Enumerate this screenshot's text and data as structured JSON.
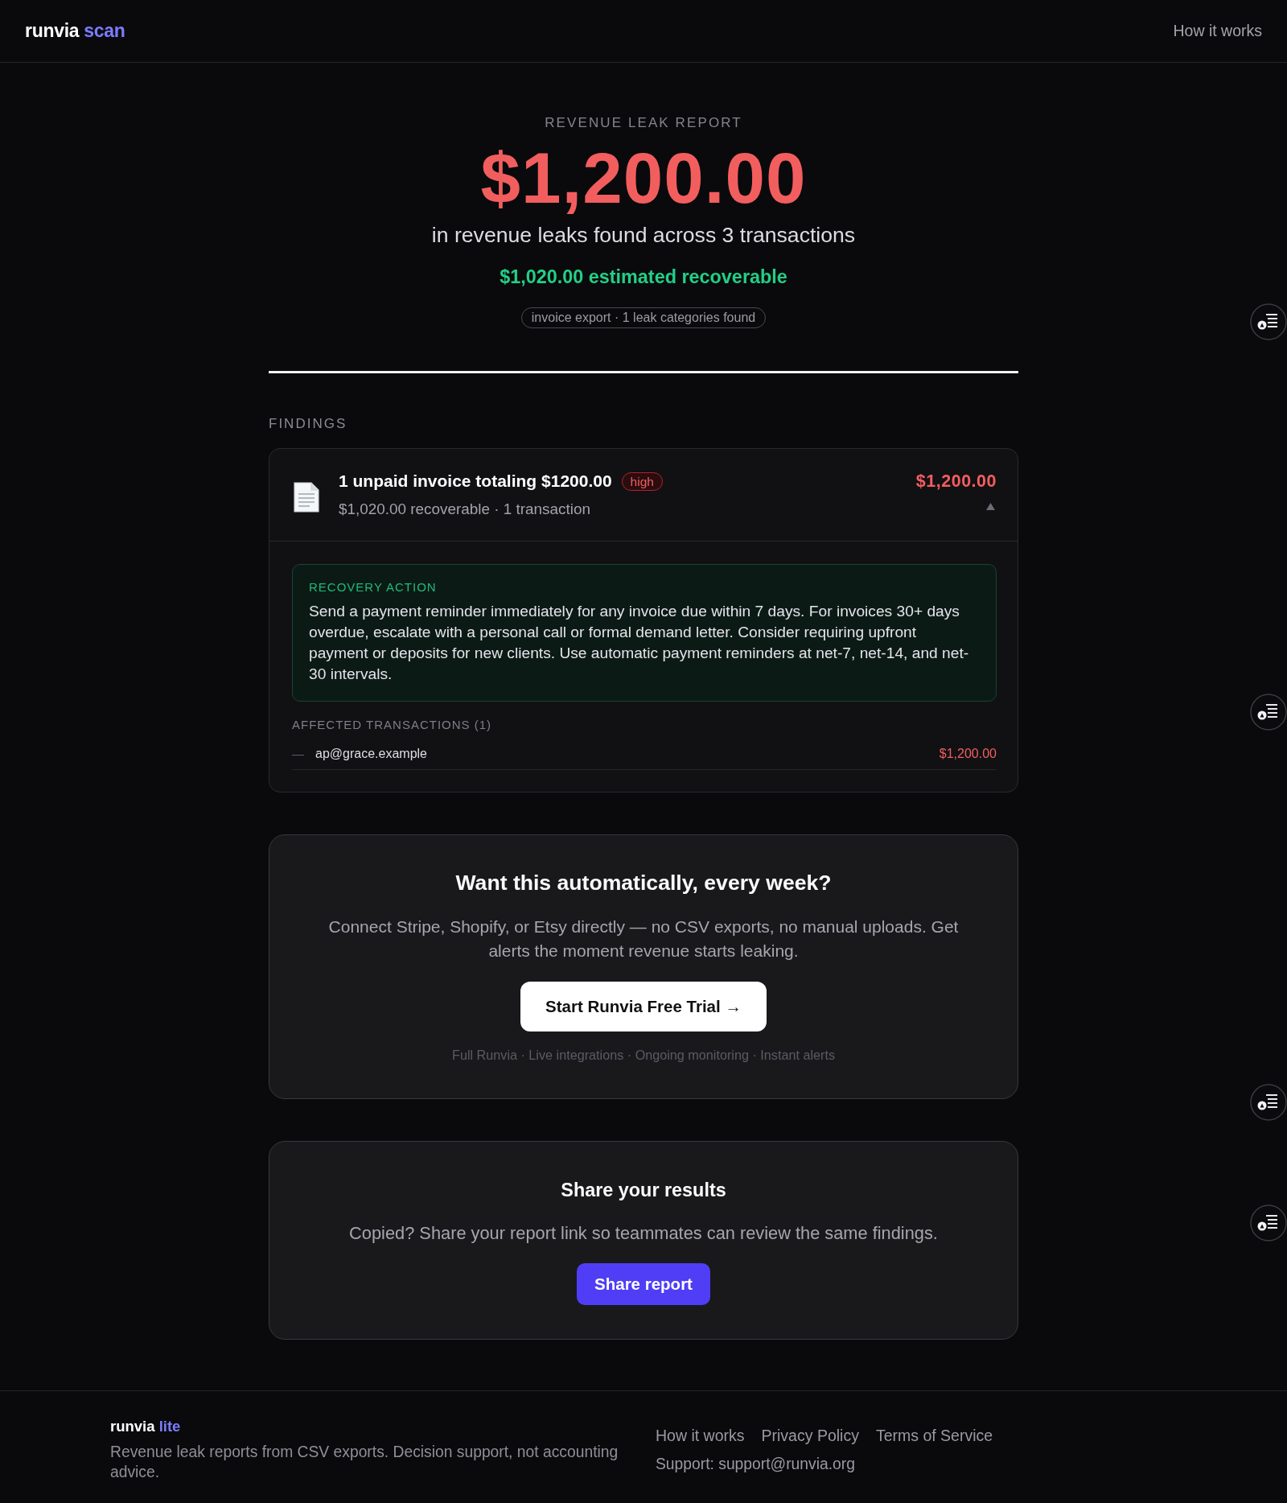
{
  "header": {
    "logo": {
      "text": "runvia",
      "accent": "scan"
    },
    "nav_link": "How it works"
  },
  "hero": {
    "eyebrow": "REVENUE LEAK REPORT",
    "total": "$1,200.00",
    "subtitle": "in revenue leaks found across 3 transactions",
    "recoverable": "$1,020.00 estimated recoverable",
    "meta_pill": "invoice export · 1 leak categories found"
  },
  "findings": {
    "heading": "FINDINGS",
    "items": [
      {
        "title": "1 unpaid invoice totaling $1200.00",
        "severity": "high",
        "subtitle": "$1,020.00 recoverable · 1 transaction",
        "amount": "$1,200.00",
        "expanded": true,
        "recovery": {
          "label": "RECOVERY ACTION",
          "text": "Send a payment reminder immediately for any invoice due within 7 days. For invoices 30+ days overdue, escalate with a personal call or formal demand letter. Consider requiring upfront payment or deposits for new clients. Use automatic payment reminders at net-7, net-14, and net-30 intervals."
        },
        "affected": {
          "heading": "AFFECTED TRANSACTIONS (1)",
          "rows": [
            {
              "marker": "—",
              "name": "ap@grace.example",
              "amount": "$1,200.00"
            }
          ]
        }
      }
    ]
  },
  "upgrade": {
    "title": "Want this automatically, every week?",
    "text": "Connect Stripe, Shopify, or Etsy directly — no CSV exports, no manual uploads. Get alerts the moment revenue starts leaking.",
    "button": "Start Runvia Free Trial →",
    "features": "Full Runvia · Live integrations · Ongoing monitoring · Instant alerts"
  },
  "share": {
    "title": "Share your results",
    "text": "Copied? Share your report link so teammates can review the same findings.",
    "button": "Share report"
  },
  "footer": {
    "brand": {
      "text": "runvia",
      "accent": "lite"
    },
    "tagline": "Revenue leak reports from CSV exports. Decision support, not accounting advice.",
    "links": [
      "How it works",
      "Privacy Policy",
      "Terms of Service"
    ],
    "support": "Support: support@runvia.org"
  }
}
